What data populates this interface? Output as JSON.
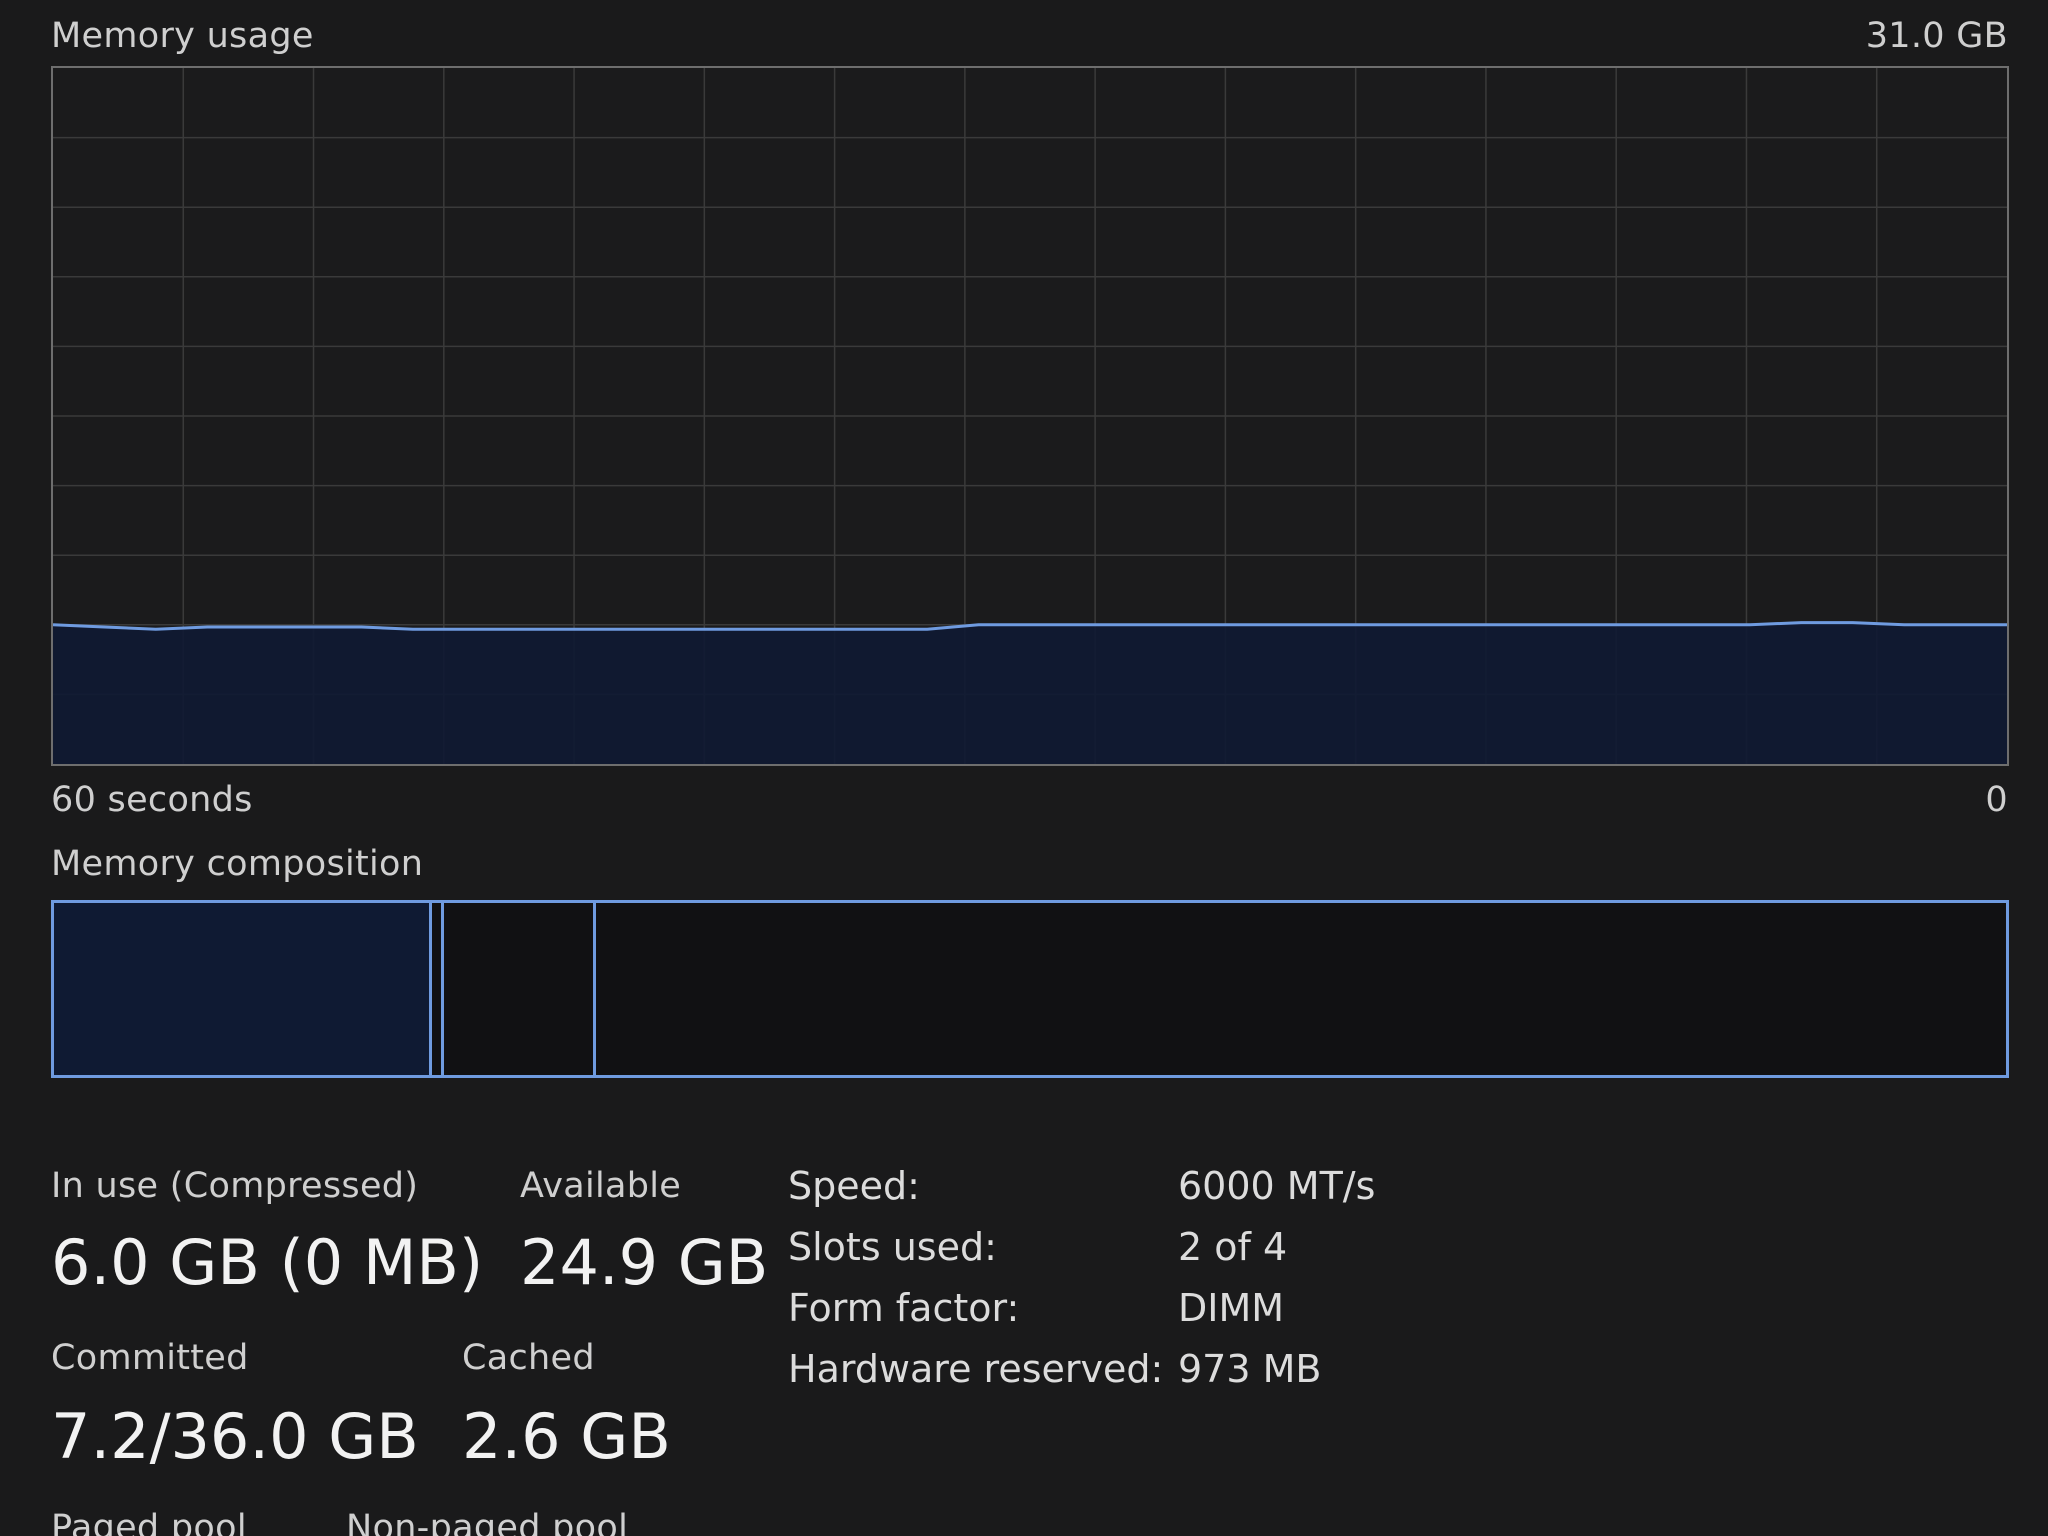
{
  "header": {
    "title": "Memory usage",
    "max_label": "31.0 GB"
  },
  "graph": {
    "x_left_label": "60 seconds",
    "x_right_label": "0",
    "line_color": "#6f9be0",
    "fill_color": "#0f1a33",
    "grid_color": "#3a3a3a",
    "max_gb": 31.0,
    "usage_gb_samples": [
      6.2,
      6.1,
      6.0,
      6.1,
      6.1,
      6.1,
      6.1,
      6.0,
      6.0,
      6.0,
      6.0,
      6.0,
      6.0,
      6.0,
      6.0,
      6.0,
      6.0,
      6.0,
      6.2,
      6.2,
      6.2,
      6.2,
      6.2,
      6.2,
      6.2,
      6.2,
      6.2,
      6.2,
      6.2,
      6.2,
      6.2,
      6.2,
      6.2,
      6.2,
      6.3,
      6.3,
      6.2,
      6.2,
      6.2
    ]
  },
  "composition": {
    "title": "Memory composition",
    "in_use_gb": 6.0,
    "cached_gb": 2.6,
    "total_gb": 31.0,
    "accent_color": "#6f9be0"
  },
  "stats": {
    "in_use": {
      "label": "In use (Compressed)",
      "value": "6.0 GB (0 MB)"
    },
    "available": {
      "label": "Available",
      "value": "24.9 GB"
    },
    "committed": {
      "label": "Committed",
      "value": "7.2/36.0 GB"
    },
    "cached": {
      "label": "Cached",
      "value": "2.6 GB"
    },
    "paged_pool": {
      "label": "Paged pool"
    },
    "non_paged_pool": {
      "label": "Non-paged pool"
    }
  },
  "details": [
    {
      "label": "Speed:",
      "value": "6000 MT/s"
    },
    {
      "label": "Slots used:",
      "value": "2 of 4"
    },
    {
      "label": "Form factor:",
      "value": "DIMM"
    },
    {
      "label": "Hardware reserved:",
      "value": "973 MB"
    }
  ]
}
